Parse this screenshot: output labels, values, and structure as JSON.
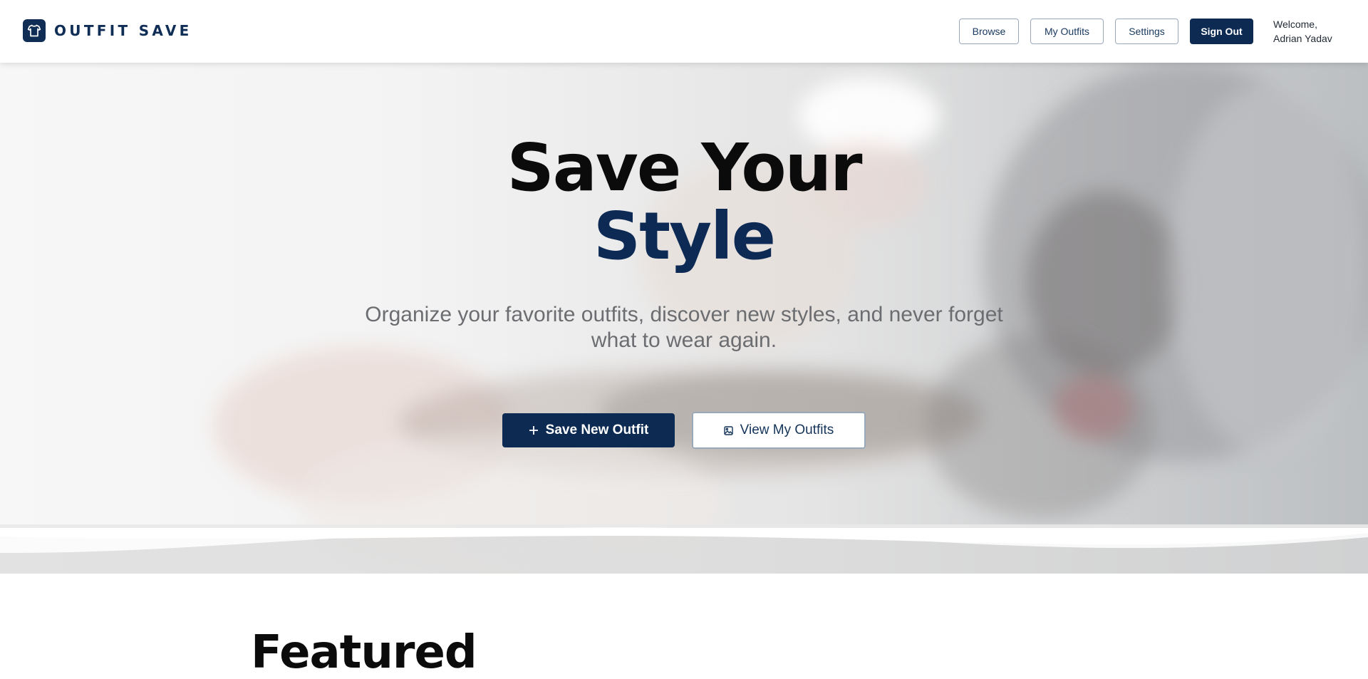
{
  "brand": {
    "name": "OUTFIT SAVE",
    "logo_icon": "tshirt-icon",
    "primary_color": "#0c2a52"
  },
  "nav": {
    "browse": "Browse",
    "my_outfits": "My Outfits",
    "settings": "Settings",
    "sign_out": "Sign Out"
  },
  "user": {
    "welcome_label": "Welcome,",
    "name": "Adrian Yadav"
  },
  "hero": {
    "headline_line1": "Save Your",
    "headline_line2": "Style",
    "subtitle": "Organize your favorite outfits, discover new styles, and never forget what to wear again.",
    "primary_cta": {
      "label": "Save New Outfit",
      "icon": "plus-icon"
    },
    "secondary_cta": {
      "label": "View My Outfits",
      "icon": "image-icon"
    }
  },
  "featured": {
    "title": "Featured"
  }
}
